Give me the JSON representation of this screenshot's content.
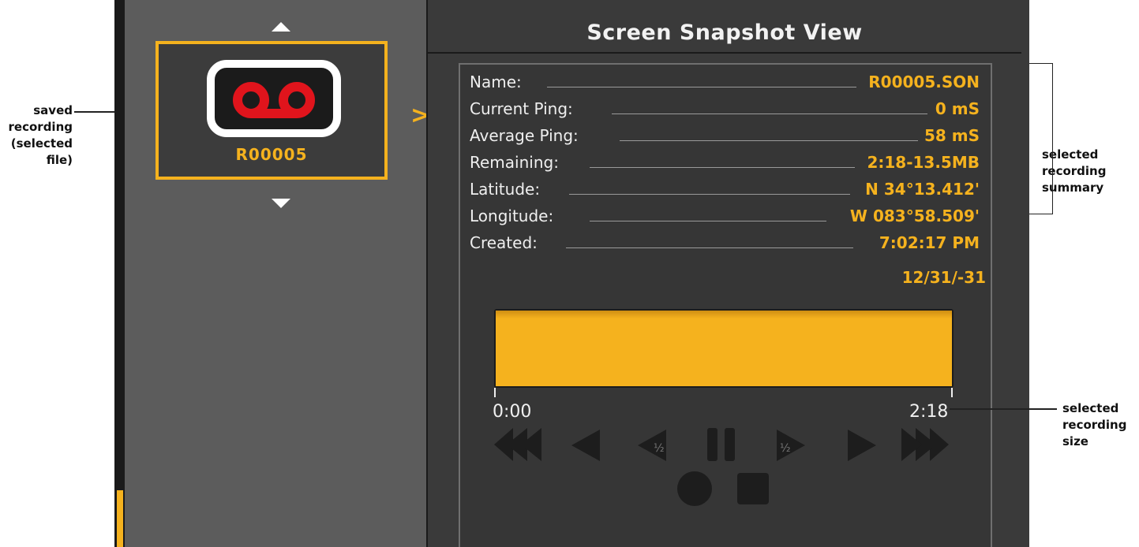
{
  "callouts": {
    "saved_recording": [
      "saved",
      "recording",
      "(selected",
      "file)"
    ],
    "summary": [
      "selected",
      "recording",
      "summary"
    ],
    "size": [
      "selected",
      "recording",
      "size"
    ]
  },
  "file_list": {
    "selected_file": "R00005",
    "icon": "voicemail-tape-icon",
    "open_chevron": ">"
  },
  "view": {
    "title": "Screen Snapshot View",
    "info": [
      {
        "label": "Name:",
        "value": "R00005.SON"
      },
      {
        "label": "Current Ping:",
        "value": "0 mS"
      },
      {
        "label": "Average Ping:",
        "value": "58 mS"
      },
      {
        "label": "Remaining:",
        "value": "2:18-13.5MB"
      },
      {
        "label": "Latitude:",
        "value": "N 34°13.412'"
      },
      {
        "label": "Longitude:",
        "value": "W 083°58.509'"
      },
      {
        "label": "Created:",
        "value": "7:02:17 PM"
      }
    ],
    "created_date": "12/31/-31",
    "playback": {
      "start": "0:00",
      "end": "2:18",
      "progress_fraction": 1.0
    },
    "controls": {
      "fast_rewind": "fast-rewind-icon",
      "rewind": "rewind-icon",
      "slow_rewind": "half-speed-rewind-icon",
      "slow_label": "½",
      "pause": "pause-icon",
      "slow_forward": "half-speed-forward-icon",
      "play": "play-icon",
      "fast_forward": "fast-forward-icon",
      "record": "record-icon",
      "stop": "stop-icon"
    }
  },
  "colors": {
    "accent": "#f5b21e",
    "record_red": "#e0141c"
  }
}
